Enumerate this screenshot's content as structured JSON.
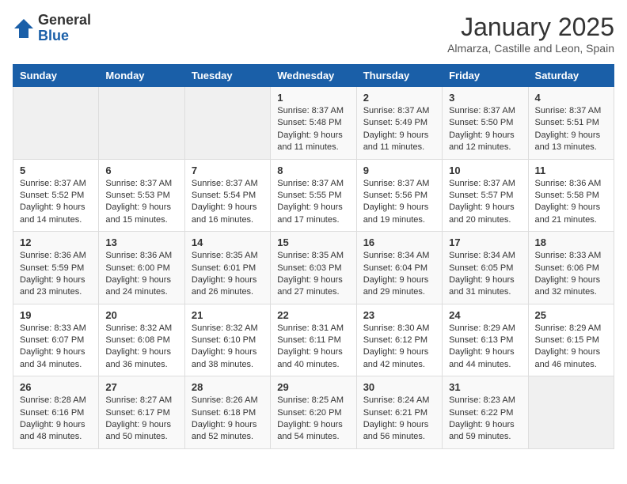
{
  "logo": {
    "general": "General",
    "blue": "Blue"
  },
  "header": {
    "title": "January 2025",
    "location": "Almarza, Castille and Leon, Spain"
  },
  "weekdays": [
    "Sunday",
    "Monday",
    "Tuesday",
    "Wednesday",
    "Thursday",
    "Friday",
    "Saturday"
  ],
  "weeks": [
    [
      {
        "day": "",
        "info": ""
      },
      {
        "day": "",
        "info": ""
      },
      {
        "day": "",
        "info": ""
      },
      {
        "day": "1",
        "info": "Sunrise: 8:37 AM\nSunset: 5:48 PM\nDaylight: 9 hours\nand 11 minutes."
      },
      {
        "day": "2",
        "info": "Sunrise: 8:37 AM\nSunset: 5:49 PM\nDaylight: 9 hours\nand 11 minutes."
      },
      {
        "day": "3",
        "info": "Sunrise: 8:37 AM\nSunset: 5:50 PM\nDaylight: 9 hours\nand 12 minutes."
      },
      {
        "day": "4",
        "info": "Sunrise: 8:37 AM\nSunset: 5:51 PM\nDaylight: 9 hours\nand 13 minutes."
      }
    ],
    [
      {
        "day": "5",
        "info": "Sunrise: 8:37 AM\nSunset: 5:52 PM\nDaylight: 9 hours\nand 14 minutes."
      },
      {
        "day": "6",
        "info": "Sunrise: 8:37 AM\nSunset: 5:53 PM\nDaylight: 9 hours\nand 15 minutes."
      },
      {
        "day": "7",
        "info": "Sunrise: 8:37 AM\nSunset: 5:54 PM\nDaylight: 9 hours\nand 16 minutes."
      },
      {
        "day": "8",
        "info": "Sunrise: 8:37 AM\nSunset: 5:55 PM\nDaylight: 9 hours\nand 17 minutes."
      },
      {
        "day": "9",
        "info": "Sunrise: 8:37 AM\nSunset: 5:56 PM\nDaylight: 9 hours\nand 19 minutes."
      },
      {
        "day": "10",
        "info": "Sunrise: 8:37 AM\nSunset: 5:57 PM\nDaylight: 9 hours\nand 20 minutes."
      },
      {
        "day": "11",
        "info": "Sunrise: 8:36 AM\nSunset: 5:58 PM\nDaylight: 9 hours\nand 21 minutes."
      }
    ],
    [
      {
        "day": "12",
        "info": "Sunrise: 8:36 AM\nSunset: 5:59 PM\nDaylight: 9 hours\nand 23 minutes."
      },
      {
        "day": "13",
        "info": "Sunrise: 8:36 AM\nSunset: 6:00 PM\nDaylight: 9 hours\nand 24 minutes."
      },
      {
        "day": "14",
        "info": "Sunrise: 8:35 AM\nSunset: 6:01 PM\nDaylight: 9 hours\nand 26 minutes."
      },
      {
        "day": "15",
        "info": "Sunrise: 8:35 AM\nSunset: 6:03 PM\nDaylight: 9 hours\nand 27 minutes."
      },
      {
        "day": "16",
        "info": "Sunrise: 8:34 AM\nSunset: 6:04 PM\nDaylight: 9 hours\nand 29 minutes."
      },
      {
        "day": "17",
        "info": "Sunrise: 8:34 AM\nSunset: 6:05 PM\nDaylight: 9 hours\nand 31 minutes."
      },
      {
        "day": "18",
        "info": "Sunrise: 8:33 AM\nSunset: 6:06 PM\nDaylight: 9 hours\nand 32 minutes."
      }
    ],
    [
      {
        "day": "19",
        "info": "Sunrise: 8:33 AM\nSunset: 6:07 PM\nDaylight: 9 hours\nand 34 minutes."
      },
      {
        "day": "20",
        "info": "Sunrise: 8:32 AM\nSunset: 6:08 PM\nDaylight: 9 hours\nand 36 minutes."
      },
      {
        "day": "21",
        "info": "Sunrise: 8:32 AM\nSunset: 6:10 PM\nDaylight: 9 hours\nand 38 minutes."
      },
      {
        "day": "22",
        "info": "Sunrise: 8:31 AM\nSunset: 6:11 PM\nDaylight: 9 hours\nand 40 minutes."
      },
      {
        "day": "23",
        "info": "Sunrise: 8:30 AM\nSunset: 6:12 PM\nDaylight: 9 hours\nand 42 minutes."
      },
      {
        "day": "24",
        "info": "Sunrise: 8:29 AM\nSunset: 6:13 PM\nDaylight: 9 hours\nand 44 minutes."
      },
      {
        "day": "25",
        "info": "Sunrise: 8:29 AM\nSunset: 6:15 PM\nDaylight: 9 hours\nand 46 minutes."
      }
    ],
    [
      {
        "day": "26",
        "info": "Sunrise: 8:28 AM\nSunset: 6:16 PM\nDaylight: 9 hours\nand 48 minutes."
      },
      {
        "day": "27",
        "info": "Sunrise: 8:27 AM\nSunset: 6:17 PM\nDaylight: 9 hours\nand 50 minutes."
      },
      {
        "day": "28",
        "info": "Sunrise: 8:26 AM\nSunset: 6:18 PM\nDaylight: 9 hours\nand 52 minutes."
      },
      {
        "day": "29",
        "info": "Sunrise: 8:25 AM\nSunset: 6:20 PM\nDaylight: 9 hours\nand 54 minutes."
      },
      {
        "day": "30",
        "info": "Sunrise: 8:24 AM\nSunset: 6:21 PM\nDaylight: 9 hours\nand 56 minutes."
      },
      {
        "day": "31",
        "info": "Sunrise: 8:23 AM\nSunset: 6:22 PM\nDaylight: 9 hours\nand 59 minutes."
      },
      {
        "day": "",
        "info": ""
      }
    ]
  ]
}
